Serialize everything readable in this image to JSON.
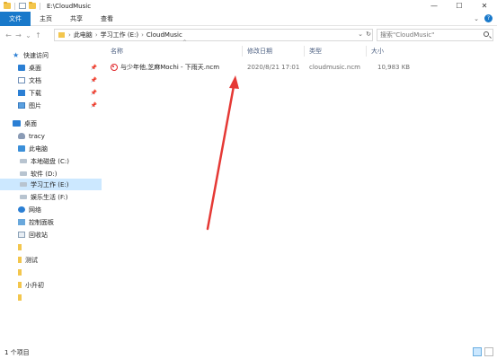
{
  "window": {
    "title": "E:\\CloudMusic",
    "controls": {
      "minimize": "—",
      "maximize": "☐",
      "close": "✕"
    }
  },
  "ribbon": {
    "tabs": [
      "文件",
      "主页",
      "共享",
      "查看"
    ],
    "help": "?"
  },
  "address": {
    "crumbs": [
      "此电脑",
      "学习工作 (E:)",
      "CloudMusic"
    ],
    "search_placeholder": "搜索\"CloudMusic\""
  },
  "nav": {
    "quick_access": "快速访问",
    "items": [
      {
        "label": "桌面",
        "icon": "desktop-icon",
        "pinned": true
      },
      {
        "label": "文档",
        "icon": "documents-icon",
        "pinned": true
      },
      {
        "label": "下载",
        "icon": "downloads-icon",
        "pinned": true
      },
      {
        "label": "图片",
        "icon": "pictures-icon",
        "pinned": true
      }
    ],
    "desktop": "桌面",
    "user": "tracy",
    "this_pc": "此电脑",
    "drives": [
      "本地磁盘 (C:)",
      "软件 (D:)",
      "学习工作 (E:)",
      "娱乐生活 (F:)"
    ],
    "network": "网络",
    "control_panel": "控制面板",
    "recycle_bin": "回收站",
    "folders": [
      "测试",
      "小升初"
    ]
  },
  "columns": {
    "name": "名称",
    "modified": "修改日期",
    "type": "类型",
    "size": "大小"
  },
  "files": [
    {
      "name": "与少年他,芝麻Mochi - 下雨天.ncm",
      "modified": "2020/8/21 17:01",
      "type": "cloudmusic.ncm",
      "size": "10,983 KB"
    }
  ],
  "status": {
    "item_count": "1 个项目"
  },
  "colors": {
    "accent": "#1979ca",
    "selection": "#cce8ff",
    "annotation": "#e53935"
  }
}
